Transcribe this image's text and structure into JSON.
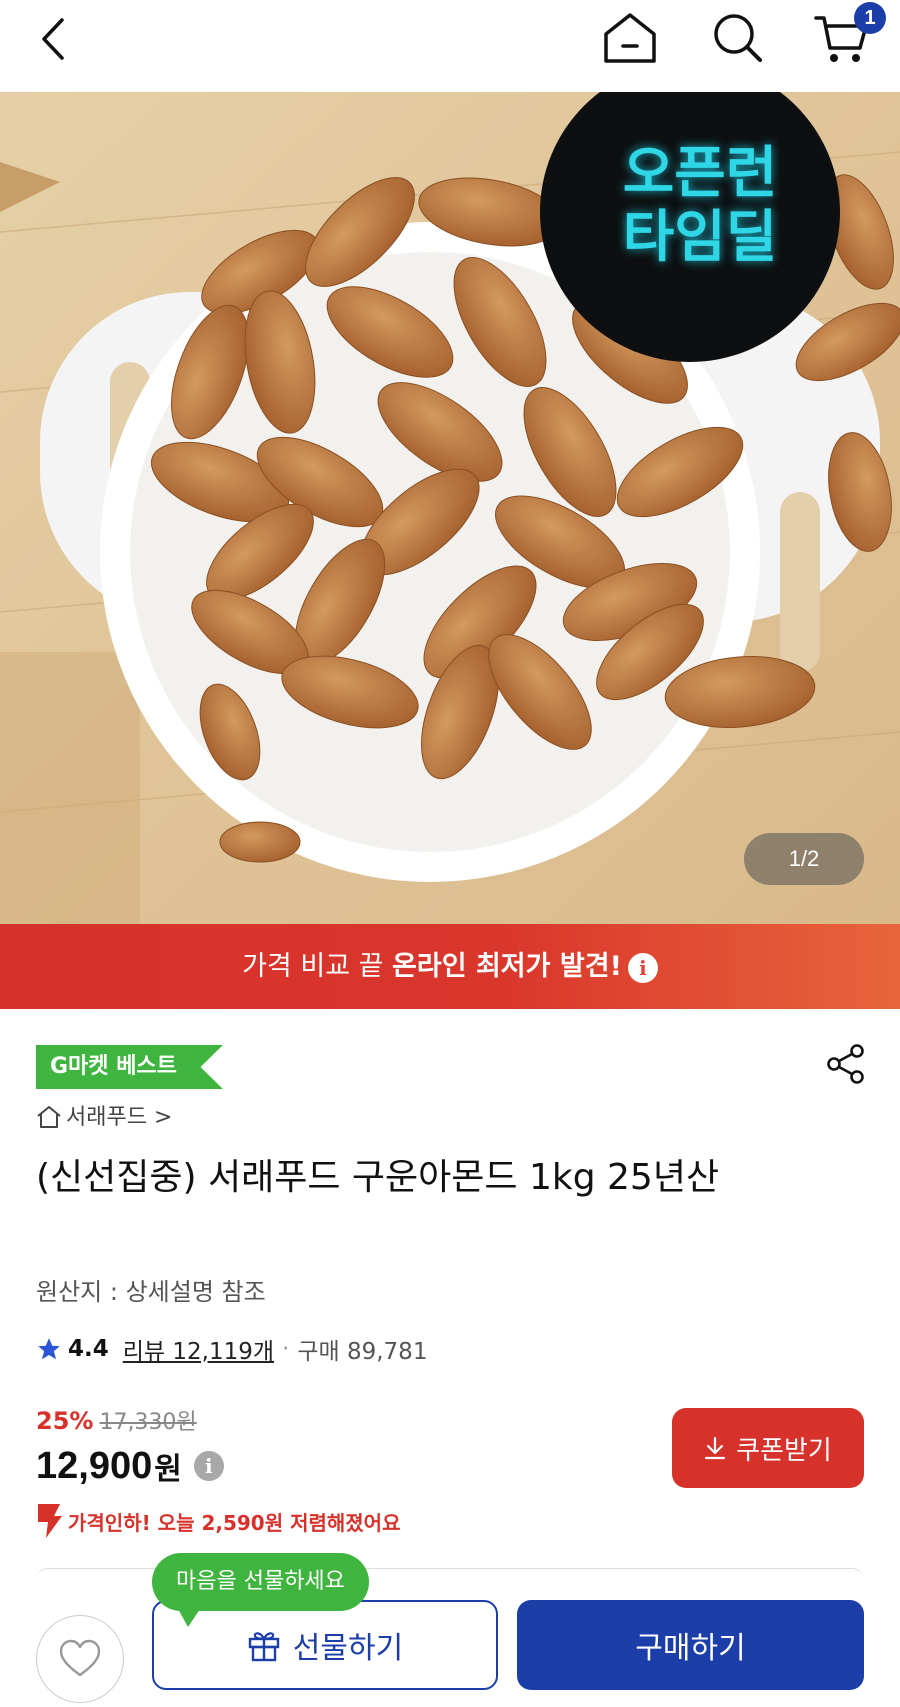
{
  "header": {
    "back_icon": "chevron-left-icon",
    "home_icon": "home-icon",
    "search_icon": "search-icon",
    "cart_icon": "cart-icon",
    "cart_count": "1"
  },
  "hero": {
    "badge_line1": "오픈런",
    "badge_line2": "타임딜",
    "page_counter": "1/2"
  },
  "promo": {
    "text_normal": "가격 비교 끝 ",
    "text_strong": "온라인 최저가 발견!",
    "info_icon": "i"
  },
  "product": {
    "best_badge": "G마켓 베스트",
    "seller": "서래푸드",
    "seller_arrow": ">",
    "title": "(신선집중) 서래푸드 구운아몬드 1kg 25년산",
    "origin": "원산지 : 상세설명 참조",
    "rating": "4.4",
    "reviews": "리뷰 12,119개",
    "separator": "·",
    "purchases": "구매 89,781",
    "discount_rate": "25%",
    "original_price": "17,330원",
    "price": "12,900",
    "price_unit": "원",
    "price_info_icon": "i",
    "coupon_label": "쿠폰받기",
    "price_drop_text": "가격인하! 오늘 2,590원 저렴해졌어요"
  },
  "bottom": {
    "gift_tooltip": "마음을 선물하세요",
    "gift_label": "선물하기",
    "buy_label": "구매하기"
  },
  "colors": {
    "brand_blue": "#1c3ea8",
    "sale_red": "#d6322b",
    "best_green": "#3fb53f"
  }
}
